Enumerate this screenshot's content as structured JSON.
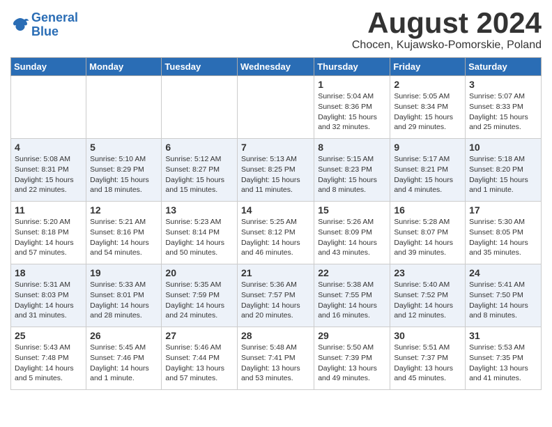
{
  "header": {
    "logo_line1": "General",
    "logo_line2": "Blue",
    "title": "August 2024",
    "subtitle": "Chocen, Kujawsko-Pomorskie, Poland"
  },
  "days_of_week": [
    "Sunday",
    "Monday",
    "Tuesday",
    "Wednesday",
    "Thursday",
    "Friday",
    "Saturday"
  ],
  "weeks": [
    [
      {
        "day": "",
        "info": ""
      },
      {
        "day": "",
        "info": ""
      },
      {
        "day": "",
        "info": ""
      },
      {
        "day": "",
        "info": ""
      },
      {
        "day": "1",
        "info": "Sunrise: 5:04 AM\nSunset: 8:36 PM\nDaylight: 15 hours\nand 32 minutes."
      },
      {
        "day": "2",
        "info": "Sunrise: 5:05 AM\nSunset: 8:34 PM\nDaylight: 15 hours\nand 29 minutes."
      },
      {
        "day": "3",
        "info": "Sunrise: 5:07 AM\nSunset: 8:33 PM\nDaylight: 15 hours\nand 25 minutes."
      }
    ],
    [
      {
        "day": "4",
        "info": "Sunrise: 5:08 AM\nSunset: 8:31 PM\nDaylight: 15 hours\nand 22 minutes."
      },
      {
        "day": "5",
        "info": "Sunrise: 5:10 AM\nSunset: 8:29 PM\nDaylight: 15 hours\nand 18 minutes."
      },
      {
        "day": "6",
        "info": "Sunrise: 5:12 AM\nSunset: 8:27 PM\nDaylight: 15 hours\nand 15 minutes."
      },
      {
        "day": "7",
        "info": "Sunrise: 5:13 AM\nSunset: 8:25 PM\nDaylight: 15 hours\nand 11 minutes."
      },
      {
        "day": "8",
        "info": "Sunrise: 5:15 AM\nSunset: 8:23 PM\nDaylight: 15 hours\nand 8 minutes."
      },
      {
        "day": "9",
        "info": "Sunrise: 5:17 AM\nSunset: 8:21 PM\nDaylight: 15 hours\nand 4 minutes."
      },
      {
        "day": "10",
        "info": "Sunrise: 5:18 AM\nSunset: 8:20 PM\nDaylight: 15 hours\nand 1 minute."
      }
    ],
    [
      {
        "day": "11",
        "info": "Sunrise: 5:20 AM\nSunset: 8:18 PM\nDaylight: 14 hours\nand 57 minutes."
      },
      {
        "day": "12",
        "info": "Sunrise: 5:21 AM\nSunset: 8:16 PM\nDaylight: 14 hours\nand 54 minutes."
      },
      {
        "day": "13",
        "info": "Sunrise: 5:23 AM\nSunset: 8:14 PM\nDaylight: 14 hours\nand 50 minutes."
      },
      {
        "day": "14",
        "info": "Sunrise: 5:25 AM\nSunset: 8:12 PM\nDaylight: 14 hours\nand 46 minutes."
      },
      {
        "day": "15",
        "info": "Sunrise: 5:26 AM\nSunset: 8:09 PM\nDaylight: 14 hours\nand 43 minutes."
      },
      {
        "day": "16",
        "info": "Sunrise: 5:28 AM\nSunset: 8:07 PM\nDaylight: 14 hours\nand 39 minutes."
      },
      {
        "day": "17",
        "info": "Sunrise: 5:30 AM\nSunset: 8:05 PM\nDaylight: 14 hours\nand 35 minutes."
      }
    ],
    [
      {
        "day": "18",
        "info": "Sunrise: 5:31 AM\nSunset: 8:03 PM\nDaylight: 14 hours\nand 31 minutes."
      },
      {
        "day": "19",
        "info": "Sunrise: 5:33 AM\nSunset: 8:01 PM\nDaylight: 14 hours\nand 28 minutes."
      },
      {
        "day": "20",
        "info": "Sunrise: 5:35 AM\nSunset: 7:59 PM\nDaylight: 14 hours\nand 24 minutes."
      },
      {
        "day": "21",
        "info": "Sunrise: 5:36 AM\nSunset: 7:57 PM\nDaylight: 14 hours\nand 20 minutes."
      },
      {
        "day": "22",
        "info": "Sunrise: 5:38 AM\nSunset: 7:55 PM\nDaylight: 14 hours\nand 16 minutes."
      },
      {
        "day": "23",
        "info": "Sunrise: 5:40 AM\nSunset: 7:52 PM\nDaylight: 14 hours\nand 12 minutes."
      },
      {
        "day": "24",
        "info": "Sunrise: 5:41 AM\nSunset: 7:50 PM\nDaylight: 14 hours\nand 8 minutes."
      }
    ],
    [
      {
        "day": "25",
        "info": "Sunrise: 5:43 AM\nSunset: 7:48 PM\nDaylight: 14 hours\nand 5 minutes."
      },
      {
        "day": "26",
        "info": "Sunrise: 5:45 AM\nSunset: 7:46 PM\nDaylight: 14 hours\nand 1 minute."
      },
      {
        "day": "27",
        "info": "Sunrise: 5:46 AM\nSunset: 7:44 PM\nDaylight: 13 hours\nand 57 minutes."
      },
      {
        "day": "28",
        "info": "Sunrise: 5:48 AM\nSunset: 7:41 PM\nDaylight: 13 hours\nand 53 minutes."
      },
      {
        "day": "29",
        "info": "Sunrise: 5:50 AM\nSunset: 7:39 PM\nDaylight: 13 hours\nand 49 minutes."
      },
      {
        "day": "30",
        "info": "Sunrise: 5:51 AM\nSunset: 7:37 PM\nDaylight: 13 hours\nand 45 minutes."
      },
      {
        "day": "31",
        "info": "Sunrise: 5:53 AM\nSunset: 7:35 PM\nDaylight: 13 hours\nand 41 minutes."
      }
    ]
  ]
}
